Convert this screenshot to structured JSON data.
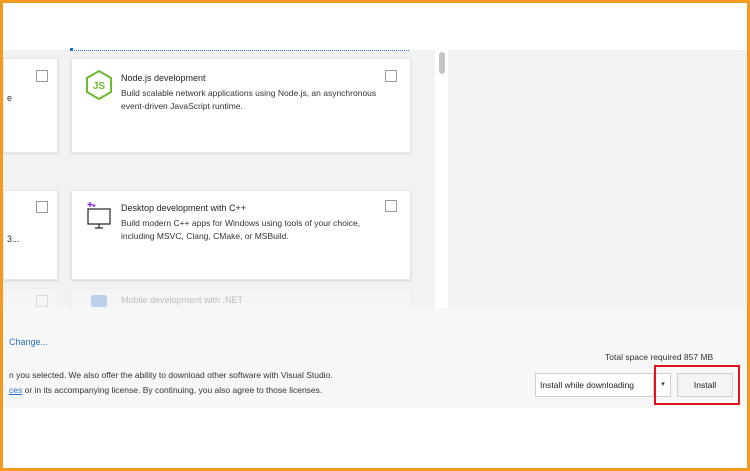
{
  "workloads": {
    "nodejs": {
      "title": "Node.js development",
      "description": "Build scalable network applications using Node.js, an asynchronous event-driven JavaScript runtime.",
      "icon": "nodejs-icon"
    },
    "cpp": {
      "title": "Desktop development with C++",
      "description": "Build modern C++ apps for Windows using tools of your choice, including MSVC, Clang, CMake, or MSBuild.",
      "icon": "desktop-cpp-icon"
    },
    "dotnet_mobile": {
      "title": "Mobile development with .NET",
      "icon": "mobile-dotnet-icon"
    },
    "left_column_fragments": [
      "e",
      "3..."
    ]
  },
  "footer": {
    "change_link": "Change...",
    "legal_line1": "n you selected. We also offer the ability to download other software with Visual Studio.",
    "legal_line2_link": "ces",
    "legal_line2_rest": " or in its accompanying license. By continuing, you also agree to those licenses.",
    "total_space": "Total space required  857 MB",
    "install_mode": "Install while downloading",
    "dropdown_arrow": "▾",
    "install_button": "Install"
  },
  "colors": {
    "frame_border": "#f39a21",
    "highlight_border": "#e0141e",
    "link": "#2a6fc4",
    "nodejs_green": "#6cbb2e",
    "cpp_purple": "#8a2be2"
  }
}
